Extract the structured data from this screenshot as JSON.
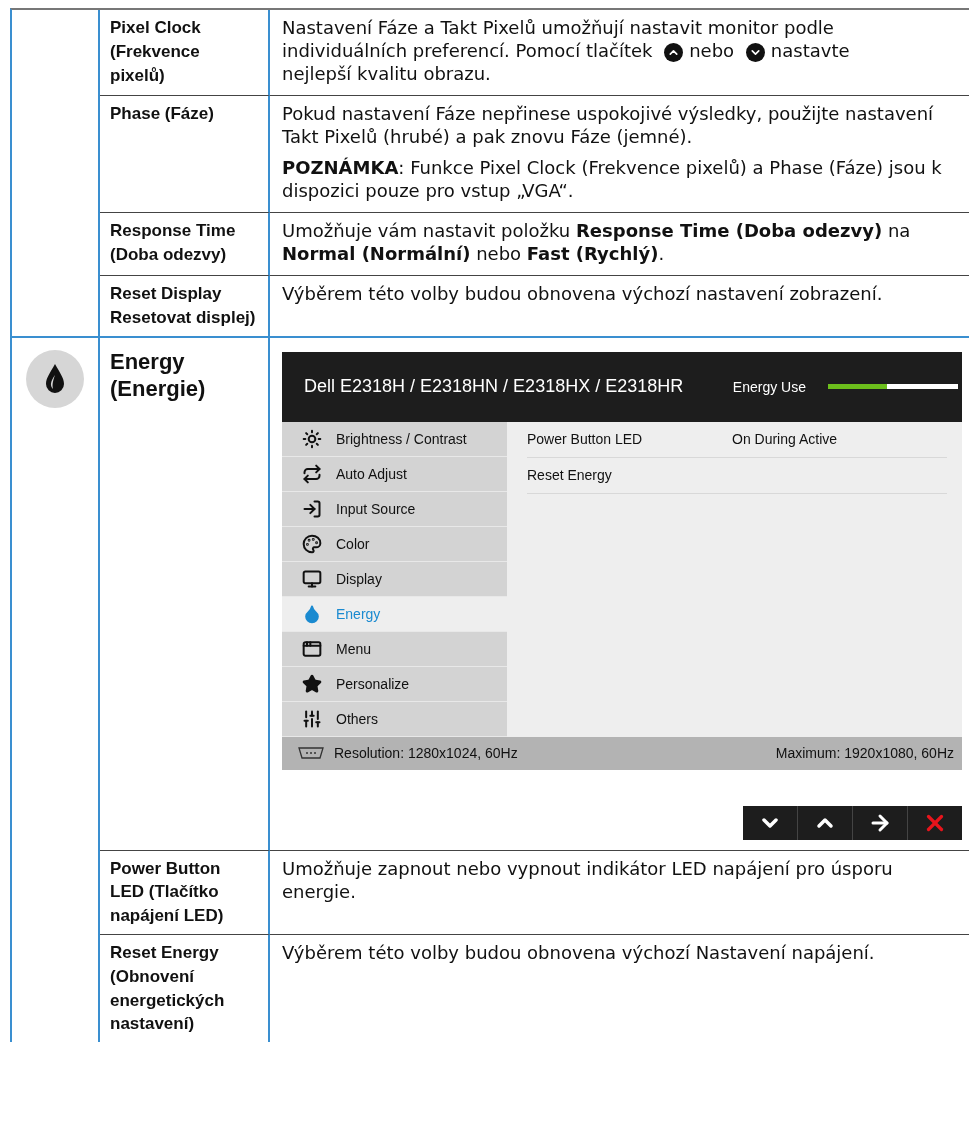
{
  "display_rows": [
    {
      "label": "Pixel Clock (Frekvence pixelů)",
      "paragraphs": [
        [
          {
            "kind": "text",
            "text": "Nastavení Fáze a Takt Pixelů umožňují nastavit monitor podle"
          },
          {
            "kind": "text",
            "text": "individuálních preferencí. Pomocí tlačítek"
          },
          {
            "kind": "up-icon"
          },
          {
            "kind": "text",
            "text": "nebo"
          },
          {
            "kind": "down-icon"
          },
          {
            "kind": "text",
            "text": "nastavte"
          },
          {
            "kind": "text",
            "text": "nejlepší kvalitu obrazu."
          }
        ]
      ]
    },
    {
      "label": "Phase (Fáze)",
      "paragraphs": [
        [
          {
            "kind": "text",
            "text": "Pokud nastavení Fáze nepřinese uspokojivé výsledky, použijte nastavení Takt Pixelů (hrubé) a pak znovu Fáze (jemné)."
          }
        ],
        [
          {
            "kind": "text",
            "text": "**POZNÁMKA**: Funkce Pixel Clock (Frekvence pixelů) a Phase (Fáze) jsou k dispozici pouze pro vstup „VGA“."
          }
        ]
      ]
    },
    {
      "label": "Response Time (Doba odezvy)",
      "paragraphs": [
        [
          {
            "kind": "text",
            "text": "Umožňuje vám nastavit položku **Response Time (Doba odezvy)** na **Normal (Normální)** nebo **Fast (Rychlý)**."
          }
        ]
      ]
    },
    {
      "label": "Reset Display Resetovat displej)",
      "paragraphs": [
        [
          {
            "kind": "text",
            "text": "Výběrem této volby budou obnovena výchozí nastavení zobrazení."
          }
        ]
      ]
    }
  ],
  "energy": {
    "label": "Energy (Energie)",
    "osd": {
      "title": "Dell E2318H / E2318HN / E2318HX / E2318HR",
      "meter_label": "Energy Use",
      "level": 0.45,
      "menu": [
        {
          "label": "Brightness / Contrast",
          "selected": false
        },
        {
          "label": "Auto Adjust",
          "selected": false
        },
        {
          "label": "Input Source",
          "selected": false
        },
        {
          "label": "Color",
          "selected": false
        },
        {
          "label": "Display",
          "selected": false
        },
        {
          "label": "Energy",
          "selected": true
        },
        {
          "label": "Menu",
          "selected": false
        },
        {
          "label": "Personalize",
          "selected": false
        },
        {
          "label": "Others",
          "selected": false
        }
      ],
      "settings": [
        {
          "name": "Power Button LED",
          "value": "On During Active"
        },
        {
          "name": "Reset Energy"
        }
      ],
      "resolution": "Resolution: 1280x1024, 60Hz",
      "maximum": "Maximum: 1920x1080, 60Hz"
    },
    "rows": [
      {
        "label": "Power Button LED (Tlačítko napájení LED)",
        "paragraphs": [
          [
            {
              "kind": "text",
              "text": "Umožňuje zapnout nebo vypnout indikátor LED napájení pro úsporu energie."
            }
          ]
        ]
      },
      {
        "label": "Reset Energy (Obnovení energetických nastavení)",
        "paragraphs": [
          [
            {
              "kind": "text",
              "text": "Výběrem této volby budou obnovena výchozí Nastavení napájení."
            }
          ]
        ]
      }
    ]
  }
}
